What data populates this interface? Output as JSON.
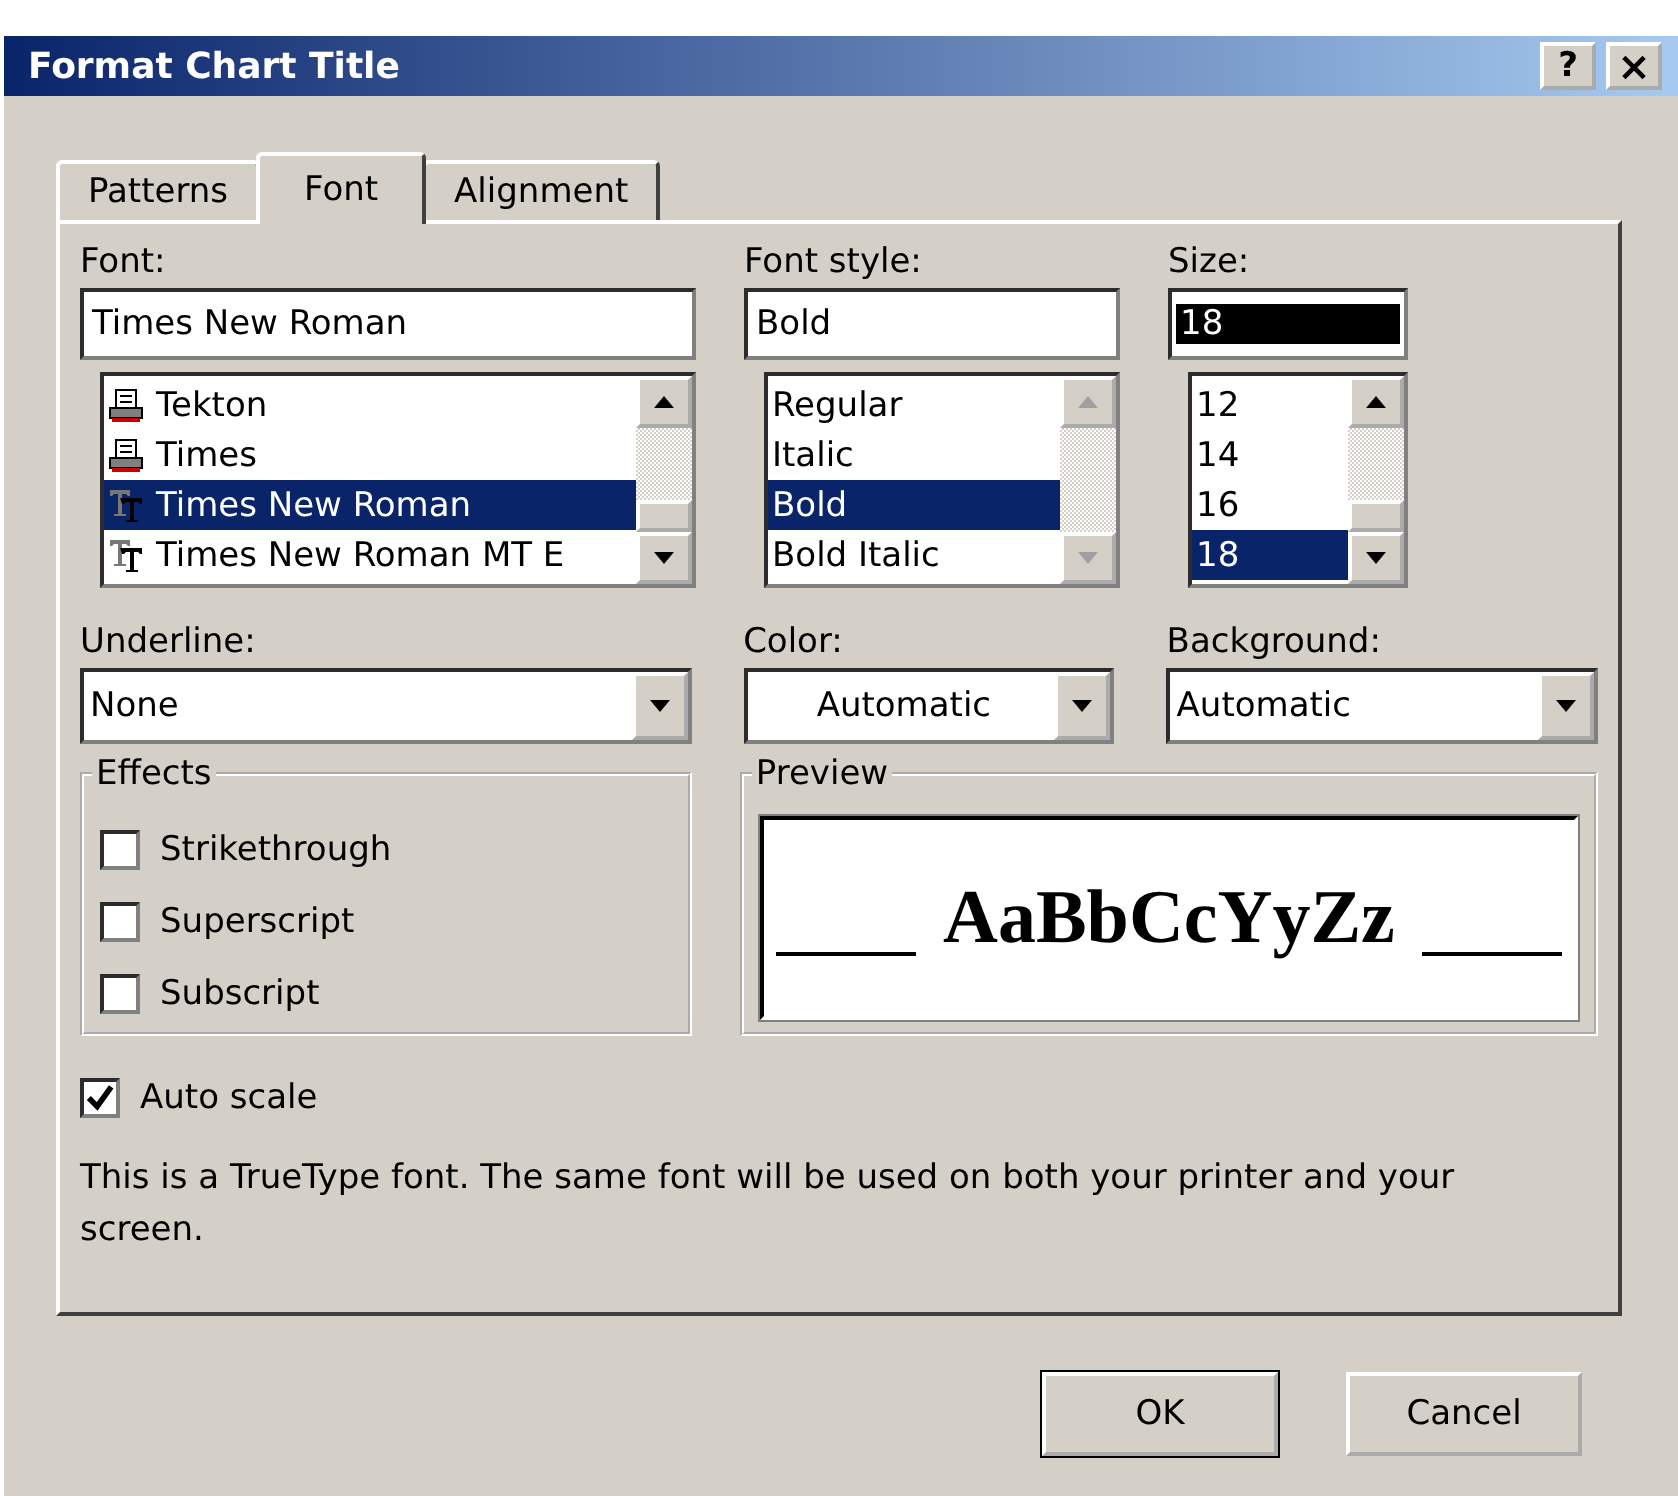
{
  "window": {
    "title": "Format Chart Title",
    "buttons": [
      {
        "kind": "help",
        "label": "?"
      },
      {
        "kind": "close",
        "label": "×"
      }
    ]
  },
  "tabs": [
    {
      "label": "Patterns",
      "selected": false
    },
    {
      "label": "Font",
      "selected": true
    },
    {
      "label": "Alignment",
      "selected": false
    }
  ],
  "font": {
    "label": "Font:",
    "value": "Times New Roman",
    "scroll_disabled": false,
    "items": [
      {
        "label": "Tekton",
        "kind": "printer",
        "selected": false
      },
      {
        "label": "Times",
        "kind": "printer",
        "selected": false
      },
      {
        "label": "Times New Roman",
        "kind": "truetype",
        "selected": true
      },
      {
        "label": "Times New Roman MT E",
        "kind": "truetype",
        "selected": false
      }
    ]
  },
  "font_style": {
    "label": "Font style:",
    "value": "Bold",
    "scroll_disabled": true,
    "items": [
      {
        "label": "Regular",
        "selected": false
      },
      {
        "label": "Italic",
        "selected": false
      },
      {
        "label": "Bold",
        "selected": true
      },
      {
        "label": "Bold Italic",
        "selected": false
      }
    ]
  },
  "size": {
    "label": "Size:",
    "value": "18",
    "value_highlighted": true,
    "scroll_disabled": false,
    "items": [
      {
        "label": "12",
        "selected": false
      },
      {
        "label": "14",
        "selected": false
      },
      {
        "label": "16",
        "selected": false
      },
      {
        "label": "18",
        "selected": true
      }
    ]
  },
  "underline": {
    "label": "Underline:",
    "value": "None"
  },
  "color": {
    "label": "Color:",
    "value": "Automatic"
  },
  "background": {
    "label": "Background:",
    "value": "Automatic"
  },
  "effects": {
    "title": "Effects",
    "options": [
      {
        "label": "Strikethrough",
        "checked": false
      },
      {
        "label": "Superscript",
        "checked": false
      },
      {
        "label": "Subscript",
        "checked": false
      }
    ]
  },
  "preview": {
    "title": "Preview",
    "sample": "AaBbCcYyZz"
  },
  "auto_scale": {
    "label": "Auto scale",
    "checked": true
  },
  "info": "This is a TrueType font.  The same font will be used on both your printer and your screen.",
  "buttons": [
    {
      "label": "OK",
      "default": true
    },
    {
      "label": "Cancel",
      "default": false
    }
  ]
}
